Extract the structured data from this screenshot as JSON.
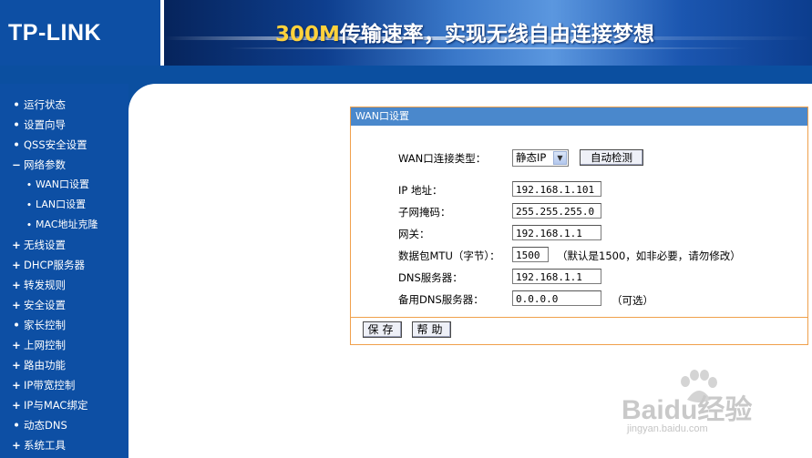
{
  "header": {
    "logo": "TP-LINK",
    "banner_accent": "300M",
    "banner_text": "传输速率，实现无线自由连接梦想"
  },
  "sidebar": {
    "items": [
      {
        "marker": "•",
        "label": "运行状态",
        "sub": false
      },
      {
        "marker": "•",
        "label": "设置向导",
        "sub": false
      },
      {
        "marker": "•",
        "label": "QSS安全设置",
        "sub": false
      },
      {
        "marker": "−",
        "label": "网络参数",
        "sub": false
      },
      {
        "marker": "•",
        "label": "WAN口设置",
        "sub": true
      },
      {
        "marker": "•",
        "label": "LAN口设置",
        "sub": true
      },
      {
        "marker": "•",
        "label": "MAC地址克隆",
        "sub": true
      },
      {
        "marker": "+",
        "label": "无线设置",
        "sub": false
      },
      {
        "marker": "+",
        "label": "DHCP服务器",
        "sub": false
      },
      {
        "marker": "+",
        "label": "转发规则",
        "sub": false
      },
      {
        "marker": "+",
        "label": "安全设置",
        "sub": false
      },
      {
        "marker": "•",
        "label": "家长控制",
        "sub": false
      },
      {
        "marker": "+",
        "label": "上网控制",
        "sub": false
      },
      {
        "marker": "+",
        "label": "路由功能",
        "sub": false
      },
      {
        "marker": "+",
        "label": "IP带宽控制",
        "sub": false
      },
      {
        "marker": "+",
        "label": "IP与MAC绑定",
        "sub": false
      },
      {
        "marker": "•",
        "label": "动态DNS",
        "sub": false
      },
      {
        "marker": "+",
        "label": "系统工具",
        "sub": false
      }
    ]
  },
  "panel": {
    "title": "WAN口设置",
    "conn_type_label": "WAN口连接类型：",
    "conn_type_value": "静态IP",
    "detect_button": "自动检测",
    "ip_label": "IP 地址：",
    "ip_value": "192.168.1.101",
    "mask_label": "子网掩码：",
    "mask_value": "255.255.255.0",
    "gateway_label": "网关：",
    "gateway_value": "192.168.1.1",
    "mtu_label": "数据包MTU（字节）：",
    "mtu_value": "1500",
    "mtu_hint": "（默认是1500，如非必要，请勿修改）",
    "dns_label": "DNS服务器：",
    "dns_value": "192.168.1.1",
    "dns2_label": "备用DNS服务器：",
    "dns2_value": "0.0.0.0",
    "dns2_hint": "（可选）",
    "save_button": "保存",
    "help_button": "帮助"
  },
  "watermark": {
    "brand": "Baidu经验",
    "url": "jingyan.baidu.com"
  },
  "colors": {
    "brand_blue": "#0d4fa4",
    "panel_title": "#4a88cc",
    "panel_border": "#f0a04b",
    "banner_accent": "#ffd23c"
  }
}
